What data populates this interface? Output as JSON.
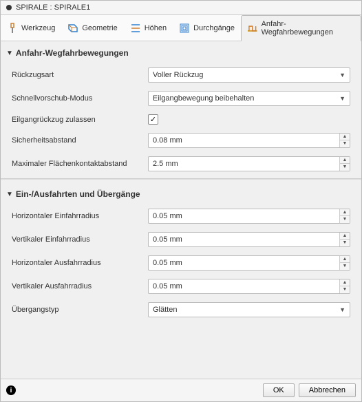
{
  "title": "SPIRALE : SPIRALE1",
  "tabs": [
    {
      "label": "Werkzeug",
      "icon": "tool"
    },
    {
      "label": "Geometrie",
      "icon": "geometry"
    },
    {
      "label": "Höhen",
      "icon": "heights"
    },
    {
      "label": "Durchgänge",
      "icon": "passes"
    },
    {
      "label": "Anfahr-Wegfahrbewegungen",
      "icon": "linking"
    }
  ],
  "section1": {
    "title": "Anfahr-Wegfahrbewegungen",
    "retract_type": {
      "label": "Rückzugsart",
      "value": "Voller Rückzug"
    },
    "rapid_mode": {
      "label": "Schnellvorschub-Modus",
      "value": "Eilgangbewegung beibehalten"
    },
    "allow_rapid": {
      "label": "Eilgangrückzug zulassen",
      "checked": true
    },
    "safety_dist": {
      "label": "Sicherheitsabstand",
      "value": "0.08 mm"
    },
    "max_contact": {
      "label": "Maximaler Flächenkontaktabstand",
      "value": "2.5 mm"
    }
  },
  "section2": {
    "title": "Ein-/Ausfahrten und Übergänge",
    "h_lead_in": {
      "label": "Horizontaler Einfahrradius",
      "value": "0.05 mm"
    },
    "v_lead_in": {
      "label": "Vertikaler Einfahrradius",
      "value": "0.05 mm"
    },
    "h_lead_out": {
      "label": "Horizontaler Ausfahrradius",
      "value": "0.05 mm"
    },
    "v_lead_out": {
      "label": "Vertikaler Ausfahrradius",
      "value": "0.05 mm"
    },
    "transition": {
      "label": "Übergangstyp",
      "value": "Glätten"
    }
  },
  "footer": {
    "ok": "OK",
    "cancel": "Abbrechen"
  }
}
